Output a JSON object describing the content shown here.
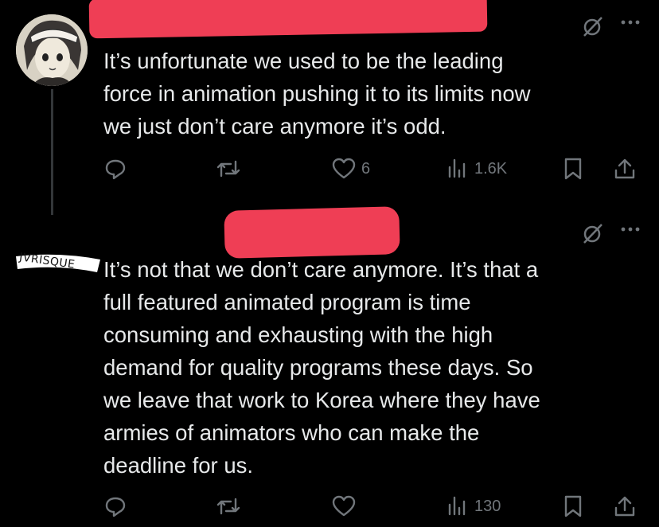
{
  "tweets": [
    {
      "text": "It’s unfortunate we used to be the leading\nforce in animation pushing it to its limits now\nwe just don’t care anymore it’s odd.",
      "actions": {
        "reply_count": "",
        "retweet_count": "",
        "like_count": "6",
        "views_count": "1.6K"
      }
    },
    {
      "avatar_text": "JVRISQUE",
      "text": "It’s not that we don’t care anymore. It’s that a\nfull featured animated program is time\nconsuming and exhausting with the high\ndemand for quality programs these days. So\nwe leave that work to Korea where they have\narmies of animators who can make the\ndeadline for us.",
      "actions": {
        "reply_count": "",
        "retweet_count": "",
        "like_count": "",
        "views_count": "130"
      }
    }
  ],
  "icons": {
    "reply": "reply-icon",
    "retweet": "retweet-icon",
    "like": "heart-icon",
    "views": "views-icon",
    "bookmark": "bookmark-icon",
    "share": "share-icon",
    "grok": "grok-icon",
    "more": "more-icon"
  },
  "colors": {
    "background": "#000000",
    "text": "#e7e9ea",
    "muted": "#71767b",
    "redaction": "#ef3e55"
  }
}
